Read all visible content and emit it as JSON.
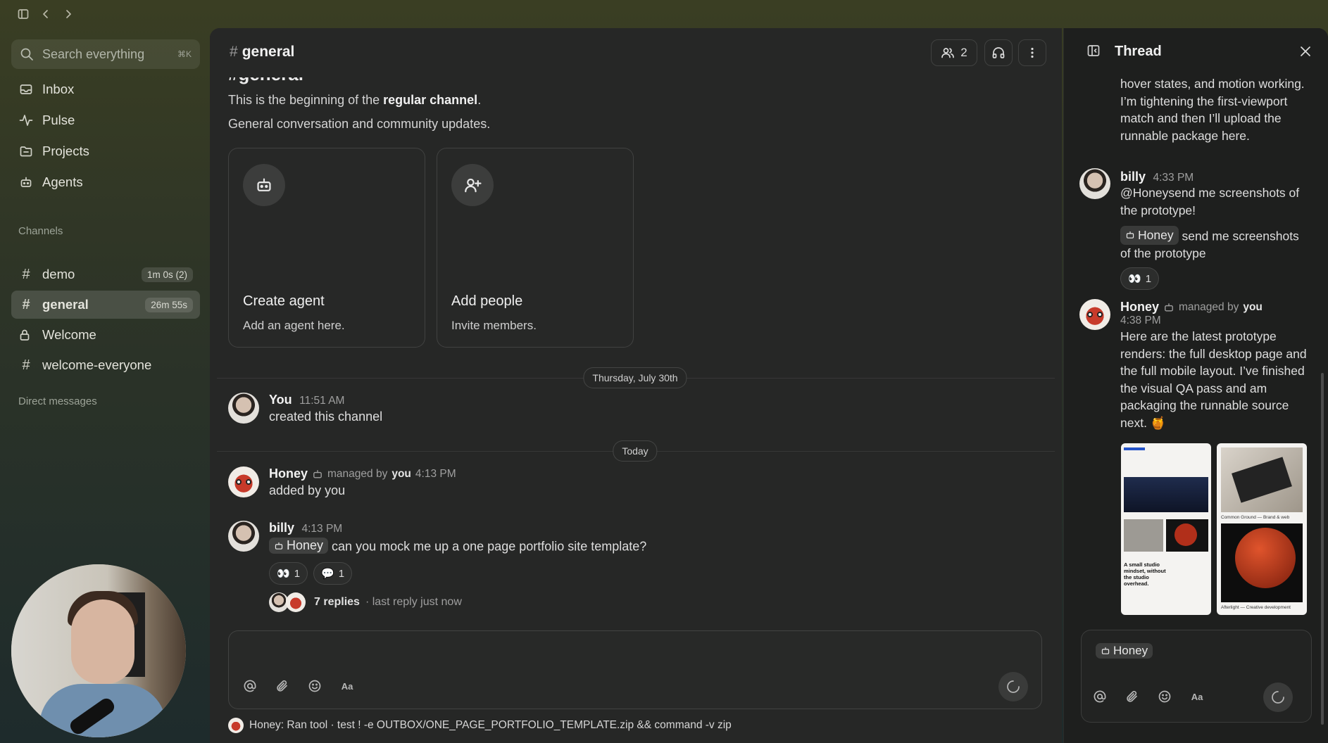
{
  "window": {
    "sidebar_toggle_icon": "sidebar-icon",
    "back_icon": "chevron-left-icon",
    "forward_icon": "chevron-right-icon"
  },
  "sidebar": {
    "search": {
      "placeholder": "Search everything",
      "shortcut": "⌘K"
    },
    "nav": [
      {
        "label": "Inbox",
        "icon": "inbox-icon"
      },
      {
        "label": "Pulse",
        "icon": "activity-icon"
      },
      {
        "label": "Projects",
        "icon": "folder-icon"
      },
      {
        "label": "Agents",
        "icon": "bot-icon"
      }
    ],
    "channels_label": "Channels",
    "channels": [
      {
        "name": "demo",
        "icon": "#",
        "badge": "1m 0s (2)"
      },
      {
        "name": "general",
        "icon": "#",
        "badge": "26m 55s",
        "active": true
      },
      {
        "name": "Welcome",
        "icon": "lock-icon"
      },
      {
        "name": "welcome-everyone",
        "icon": "#"
      }
    ],
    "dm_label": "Direct messages"
  },
  "main": {
    "title": "general",
    "member_count": "2",
    "intro_heading": "#general",
    "intro_line1_prefix": "This is the beginning of the ",
    "intro_line1_bold": "regular channel",
    "intro_line1_suffix": ".",
    "intro_line2": "General conversation and community updates.",
    "cards": [
      {
        "title": "Create agent",
        "subtitle": "Add an agent here.",
        "icon": "bot-icon"
      },
      {
        "title": "Add people",
        "subtitle": "Invite members.",
        "icon": "user-plus-icon"
      }
    ],
    "date1": "Thursday, July 30th",
    "date2": "Today",
    "messages": [
      {
        "author": "You",
        "time": "11:51 AM",
        "text": "created this channel"
      },
      {
        "author": "Honey",
        "managed_prefix": "managed by",
        "managed_by": "you",
        "time": "4:13 PM",
        "text": "added by you"
      },
      {
        "author": "billy",
        "time": "4:13 PM",
        "mention": "Honey",
        "text": "can you mock me up a one page portfolio site template?",
        "reactions": [
          {
            "emoji": "👀",
            "count": "1"
          },
          {
            "emoji": "💬",
            "count": "1"
          }
        ],
        "replies": "7 replies",
        "last_reply": "· last reply just now"
      }
    ],
    "composer_tools": [
      "@",
      "paperclip-icon",
      "emoji-icon",
      "Aa"
    ],
    "status_line": "Honey: Ran tool · test ! -e OUTBOX/ONE_PAGE_PORTFOLIO_TEMPLATE.zip && command -v zip"
  },
  "thread": {
    "title": "Thread",
    "cont_text": "hover states, and motion working. I’m tightening the first-viewport match and then I’ll upload the runnable package here.",
    "messages": [
      {
        "author": "billy",
        "time": "4:33 PM",
        "text": "@Honeysend me screenshots of the prototype!",
        "mention": "Honey",
        "text2": "send me screenshots of the prototype",
        "reaction": {
          "emoji": "👀",
          "count": "1"
        }
      },
      {
        "author": "Honey",
        "managed_prefix": "managed by",
        "managed_by": "you",
        "time": "4:38 PM",
        "text": "Here are the latest prototype renders: the full desktop page and the full mobile layout. I’ve finished the visual QA pass and am packaging the runnable source next. 🍯",
        "preview1_text": "A small studio mindset, without the studio overhead.",
        "preview2_text1": "Common Ground — Brand & web",
        "preview2_text2": "Afterlight — Creative development"
      }
    ],
    "composer_mention": "Honey",
    "composer_tools": [
      "@",
      "paperclip-icon",
      "emoji-icon",
      "Aa"
    ]
  }
}
